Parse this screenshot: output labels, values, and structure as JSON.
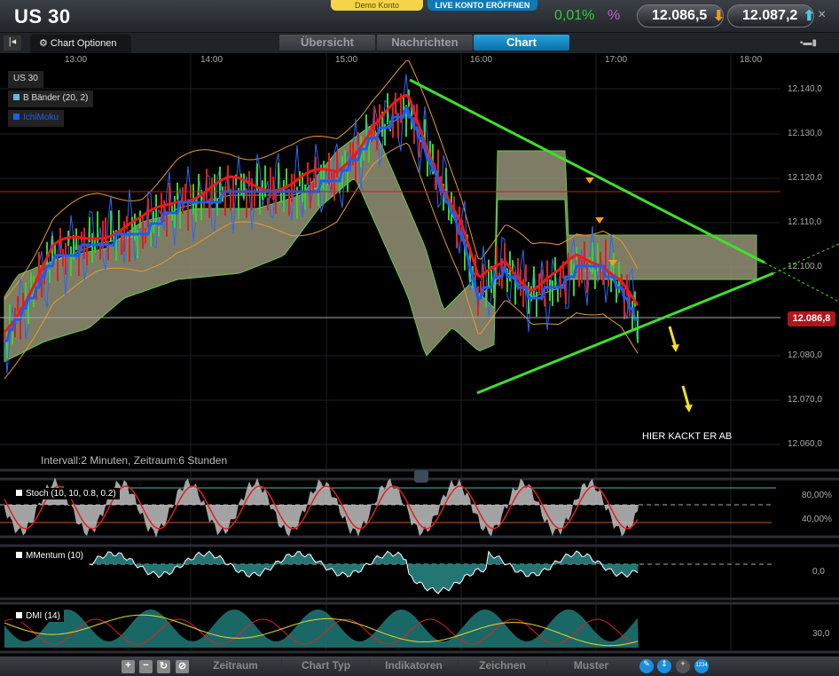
{
  "header": {
    "title": "US 30",
    "demo_label": "Demo Konto",
    "live_label": "LIVE KONTO ERÖFFNEN",
    "change": "0,01%",
    "percent_symbol": "%",
    "sell_price": "12.086,5",
    "buy_price": "12.087,2",
    "close": "×"
  },
  "tabs": {
    "chart_options": "Chart Optionen",
    "items": [
      {
        "label": "Übersicht"
      },
      {
        "label": "Nachrichten"
      },
      {
        "label": "Chart"
      }
    ],
    "active": "Chart"
  },
  "chart": {
    "time_labels": [
      "13:00",
      "14:00",
      "15:00",
      "16:00",
      "17:00",
      "18:00"
    ],
    "price_labels": [
      "12.140,0",
      "12.130,0",
      "12.120,0",
      "12.110,0",
      "12.100,0",
      "12.080,0",
      "12.070,0",
      "12.060,0"
    ],
    "current_price": "12.086,8",
    "legend": [
      {
        "label": "US 30"
      },
      {
        "label": "B Bänder (20, 2)",
        "color": "#5bc0d8"
      },
      {
        "label": "IchiMoku",
        "color": "#1a5ef0"
      }
    ],
    "interval_text": "Intervall:2 Minuten, Zeitraum:6 Stunden",
    "annotation": "HIER KACKT ER AB"
  },
  "indicators": [
    {
      "label": "Stoch (10, 10, 0.8, 0.2)",
      "levels": [
        "80,00%",
        "40,00%"
      ]
    },
    {
      "label": "MMentum (10)",
      "levels": [
        "0,0"
      ]
    },
    {
      "label": "DMI (14)",
      "levels": [
        "30,0"
      ]
    }
  ],
  "toolbar": {
    "items": [
      "Zeitraum",
      "Chart Typ",
      "Indikatoren",
      "Zeichnen",
      "Muster"
    ],
    "zoom_in": "+",
    "zoom_out": "−",
    "badge": "1234"
  }
}
